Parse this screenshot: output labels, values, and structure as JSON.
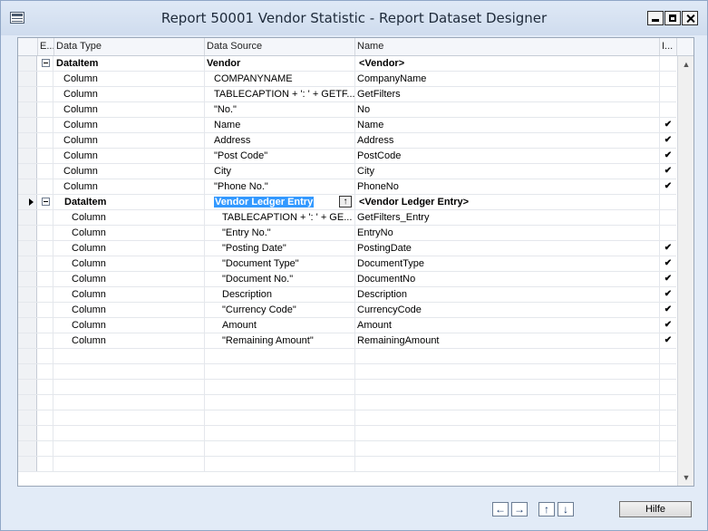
{
  "window": {
    "title": "Report 50001 Vendor Statistic - Report Dataset Designer"
  },
  "columns": {
    "expand": "E...",
    "data_type": "Data Type",
    "data_source": "Data Source",
    "name": "Name",
    "include": "I..."
  },
  "rows": [
    {
      "data_type": "DataItem",
      "data_source": "Vendor",
      "name": "<Vendor>",
      "include": ""
    },
    {
      "data_type": "Column",
      "data_source": "COMPANYNAME",
      "name": "CompanyName",
      "include": ""
    },
    {
      "data_type": "Column",
      "data_source": "TABLECAPTION + ': ' + GETF...",
      "name": "GetFilters",
      "include": ""
    },
    {
      "data_type": "Column",
      "data_source": "\"No.\"",
      "name": "No",
      "include": ""
    },
    {
      "data_type": "Column",
      "data_source": "Name",
      "name": "Name",
      "include": "✔"
    },
    {
      "data_type": "Column",
      "data_source": "Address",
      "name": "Address",
      "include": "✔"
    },
    {
      "data_type": "Column",
      "data_source": "\"Post Code\"",
      "name": "PostCode",
      "include": "✔"
    },
    {
      "data_type": "Column",
      "data_source": "City",
      "name": "City",
      "include": "✔"
    },
    {
      "data_type": "Column",
      "data_source": "\"Phone No.\"",
      "name": "PhoneNo",
      "include": "✔"
    },
    {
      "data_type": "DataItem",
      "data_source": "Vendor Ledger Entry",
      "name": "<Vendor Ledger Entry>",
      "include": ""
    },
    {
      "data_type": "Column",
      "data_source": "TABLECAPTION + ': ' + GE...",
      "name": "GetFilters_Entry",
      "include": ""
    },
    {
      "data_type": "Column",
      "data_source": "\"Entry No.\"",
      "name": "EntryNo",
      "include": ""
    },
    {
      "data_type": "Column",
      "data_source": "\"Posting Date\"",
      "name": "PostingDate",
      "include": "✔"
    },
    {
      "data_type": "Column",
      "data_source": "\"Document Type\"",
      "name": "DocumentType",
      "include": "✔"
    },
    {
      "data_type": "Column",
      "data_source": "\"Document No.\"",
      "name": "DocumentNo",
      "include": "✔"
    },
    {
      "data_type": "Column",
      "data_source": "Description",
      "name": "Description",
      "include": "✔"
    },
    {
      "data_type": "Column",
      "data_source": "\"Currency Code\"",
      "name": "CurrencyCode",
      "include": "✔"
    },
    {
      "data_type": "Column",
      "data_source": "Amount",
      "name": "Amount",
      "include": "✔"
    },
    {
      "data_type": "Column",
      "data_source": "\"Remaining Amount\"",
      "name": "RemainingAmount",
      "include": "✔"
    }
  ],
  "buttons": {
    "help": "Hilfe",
    "scroll_up": "▲",
    "scroll_down": "▼",
    "move_left": "←",
    "move_right": "→",
    "move_up": "↑",
    "move_down": "↓",
    "lookup": "↑"
  }
}
